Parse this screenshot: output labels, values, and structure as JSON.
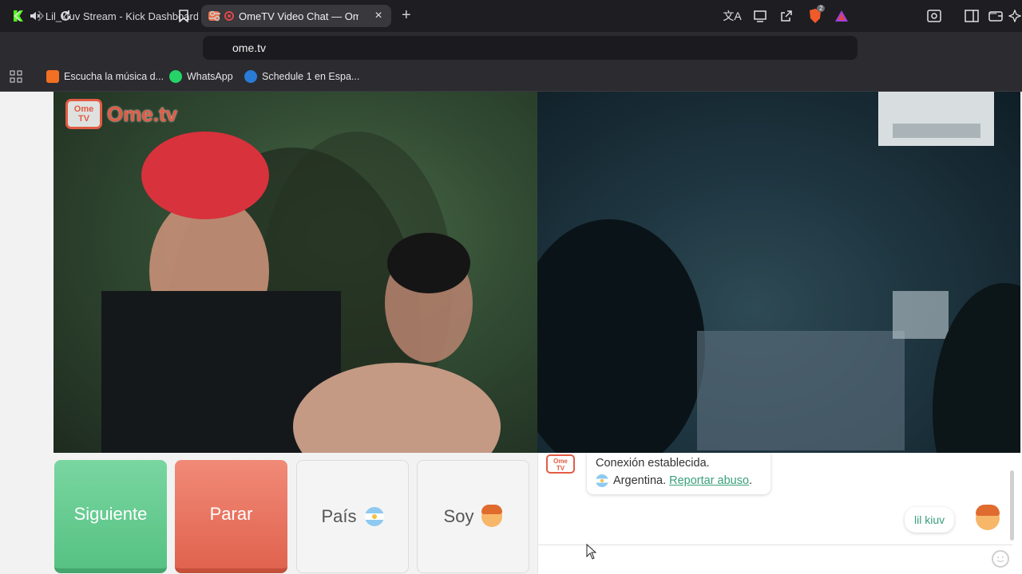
{
  "browser": {
    "tabs": [
      {
        "title": "Lil_kiuv Stream - Kick Dashboard",
        "icon": "kick-icon",
        "muted": true
      },
      {
        "title": "OmeTV Video Chat — Omegl",
        "icon": "ometv-favicon",
        "recording": true,
        "active": true
      }
    ],
    "address": "ome.tv",
    "bookmarks": [
      {
        "label": "Escucha la música d...",
        "icon": "soundcloud-icon"
      },
      {
        "label": "WhatsApp",
        "icon": "whatsapp-icon"
      },
      {
        "label": "Schedule 1 en Espa...",
        "icon": "steam-icon"
      }
    ],
    "brave_badge": "2"
  },
  "ometv": {
    "logo_text": "Ome.tv",
    "logo_tv_line1": "Ome",
    "logo_tv_line2": "TV",
    "controls": {
      "next": "Siguiente",
      "stop": "Parar",
      "country": "País",
      "gender": "Soy"
    },
    "chat": {
      "system_line1": "Conexión establecida.",
      "country": "Argentina.",
      "report_link": "Reportar abuso",
      "report_suffix": ".",
      "user_message": "lil kiuv"
    }
  },
  "colors": {
    "next_green": "#56c283",
    "stop_red": "#e0634e",
    "brand_orange": "#e25b44",
    "link_green": "#3aa07a"
  }
}
